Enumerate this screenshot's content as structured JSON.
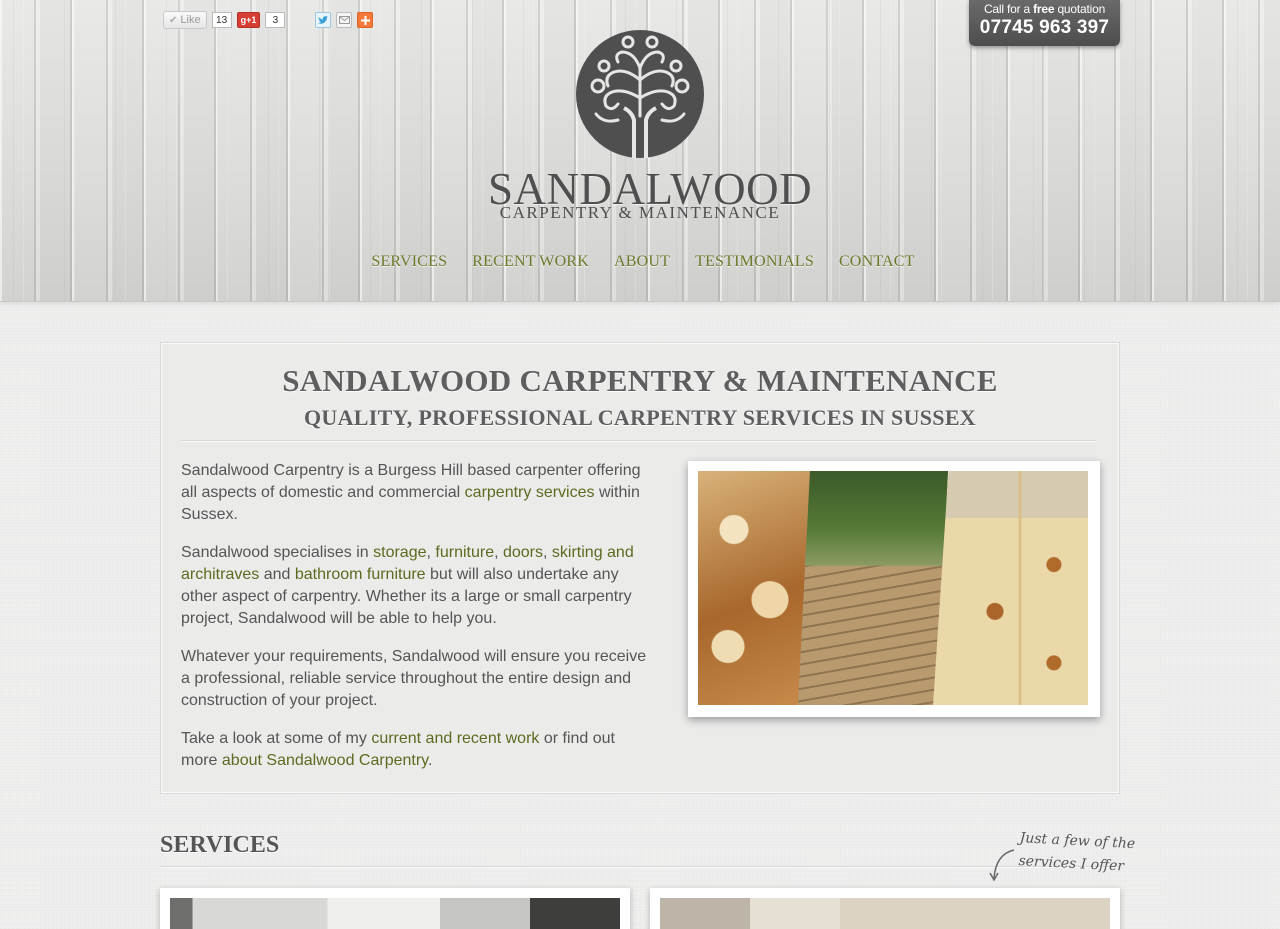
{
  "social": {
    "like_label": "Like",
    "like_count": "13",
    "gplus_label": "+1",
    "gplus_count": "3"
  },
  "quote": {
    "line_prefix": "Call for a ",
    "line_bold": "free",
    "line_suffix": " quotation",
    "phone": "07745 963 397"
  },
  "logo": {
    "name": "SANDALWOOD",
    "tagline": "CARPENTRY & MAINTENANCE"
  },
  "nav": {
    "items": [
      {
        "label": "SERVICES"
      },
      {
        "label": "RECENT WORK"
      },
      {
        "label": "ABOUT"
      },
      {
        "label": "TESTIMONIALS"
      },
      {
        "label": "CONTACT"
      }
    ]
  },
  "main": {
    "title": "SANDALWOOD CARPENTRY & MAINTENANCE",
    "subtitle": "QUALITY, PROFESSIONAL CARPENTRY SERVICES IN SUSSEX",
    "p1": {
      "text1": "Sandalwood Carpentry is a Burgess Hill based carpenter offering all aspects of domestic and commercial ",
      "link1": "carpentry services",
      "text2": " within Sussex."
    },
    "p2": {
      "text1": "Sandalwood specialises in ",
      "link_storage": "storage",
      "sep1": ", ",
      "link_furniture": "furniture",
      "sep2": ", ",
      "link_doors": "doors",
      "sep3": ", ",
      "link_skirting": "skirting and architraves",
      "sep4": " and ",
      "link_bathroom": "bathroom furniture",
      "text2": " but will also undertake any other aspect of carpentry. Whether its a large or small carpentry project, Sandalwood will be able to help you."
    },
    "p3": "Whatever your requirements, Sandalwood will ensure you receive a professional, reliable service throughout the entire design and construction of your project.",
    "p4": {
      "text1": "Take a look at some of my ",
      "link1": "current and recent work",
      "text2": " or find out more ",
      "link2": "about Sandalwood Carpentry",
      "text3": "."
    }
  },
  "services": {
    "heading": "SERVICES",
    "note_line1": "Just a few of the",
    "note_line2": "services I offer"
  },
  "colors": {
    "link": "#5b6b1f",
    "nav": "#6a7a2a",
    "logo": "#4f4f4f",
    "quote_tab": "#555555"
  }
}
